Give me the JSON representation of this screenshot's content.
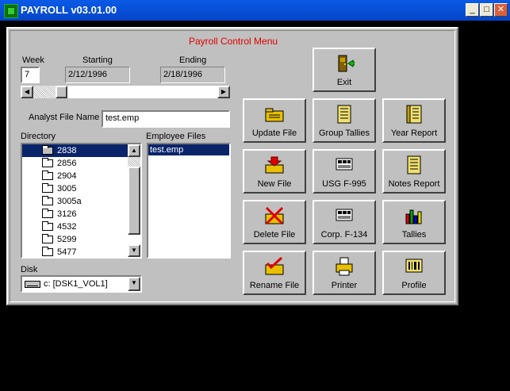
{
  "window": {
    "title": "PAYROLL v03.01.00",
    "minimize": "_",
    "maximize": "□",
    "close": "✕"
  },
  "menu": {
    "title": "Payroll Control Menu",
    "week_label": "Week",
    "week_value": "7",
    "starting_label": "Starting",
    "starting_value": "2/12/1996",
    "ending_label": "Ending",
    "ending_value": "2/18/1996",
    "analyst_label": "Analyst File Name",
    "analyst_value": "test.emp",
    "directory_label": "Directory",
    "employee_label": "Employee Files",
    "disk_label": "Disk",
    "disk_value": "c: [DSK1_VOL1]"
  },
  "directory": [
    "2838",
    "2856",
    "2904",
    "3005",
    "3005a",
    "3126",
    "4532",
    "5299",
    "5477"
  ],
  "directory_selected": "2838",
  "employee_files": [
    "test.emp"
  ],
  "buttons": {
    "exit": "Exit",
    "update_file": "Update File",
    "group_tallies": "Group Tallies",
    "year_report": "Year Report",
    "new_file": "New File",
    "usg": "USG  F-995",
    "notes_report": "Notes Report",
    "delete_file": "Delete File",
    "corp": "Corp. F-134",
    "tallies": "Tallies",
    "rename_file": "Rename File",
    "printer": "Printer",
    "profile": "Profile"
  },
  "icons": {
    "exit": "door-exit-icon",
    "update": "folder-update-icon",
    "group": "ledger-icon",
    "year": "report-book-icon",
    "new": "new-file-icon",
    "usg": "form-icon",
    "notes": "notes-icon",
    "delete": "delete-file-icon",
    "corp": "form-icon",
    "tallies": "bar-chart-icon",
    "rename": "rename-file-icon",
    "printer": "printer-icon",
    "profile": "barcode-icon"
  },
  "colors": {
    "title_bar": "#0545c8",
    "menu_title": "#e00000",
    "selection": "#0a246a",
    "panel": "#c0c0c0"
  }
}
